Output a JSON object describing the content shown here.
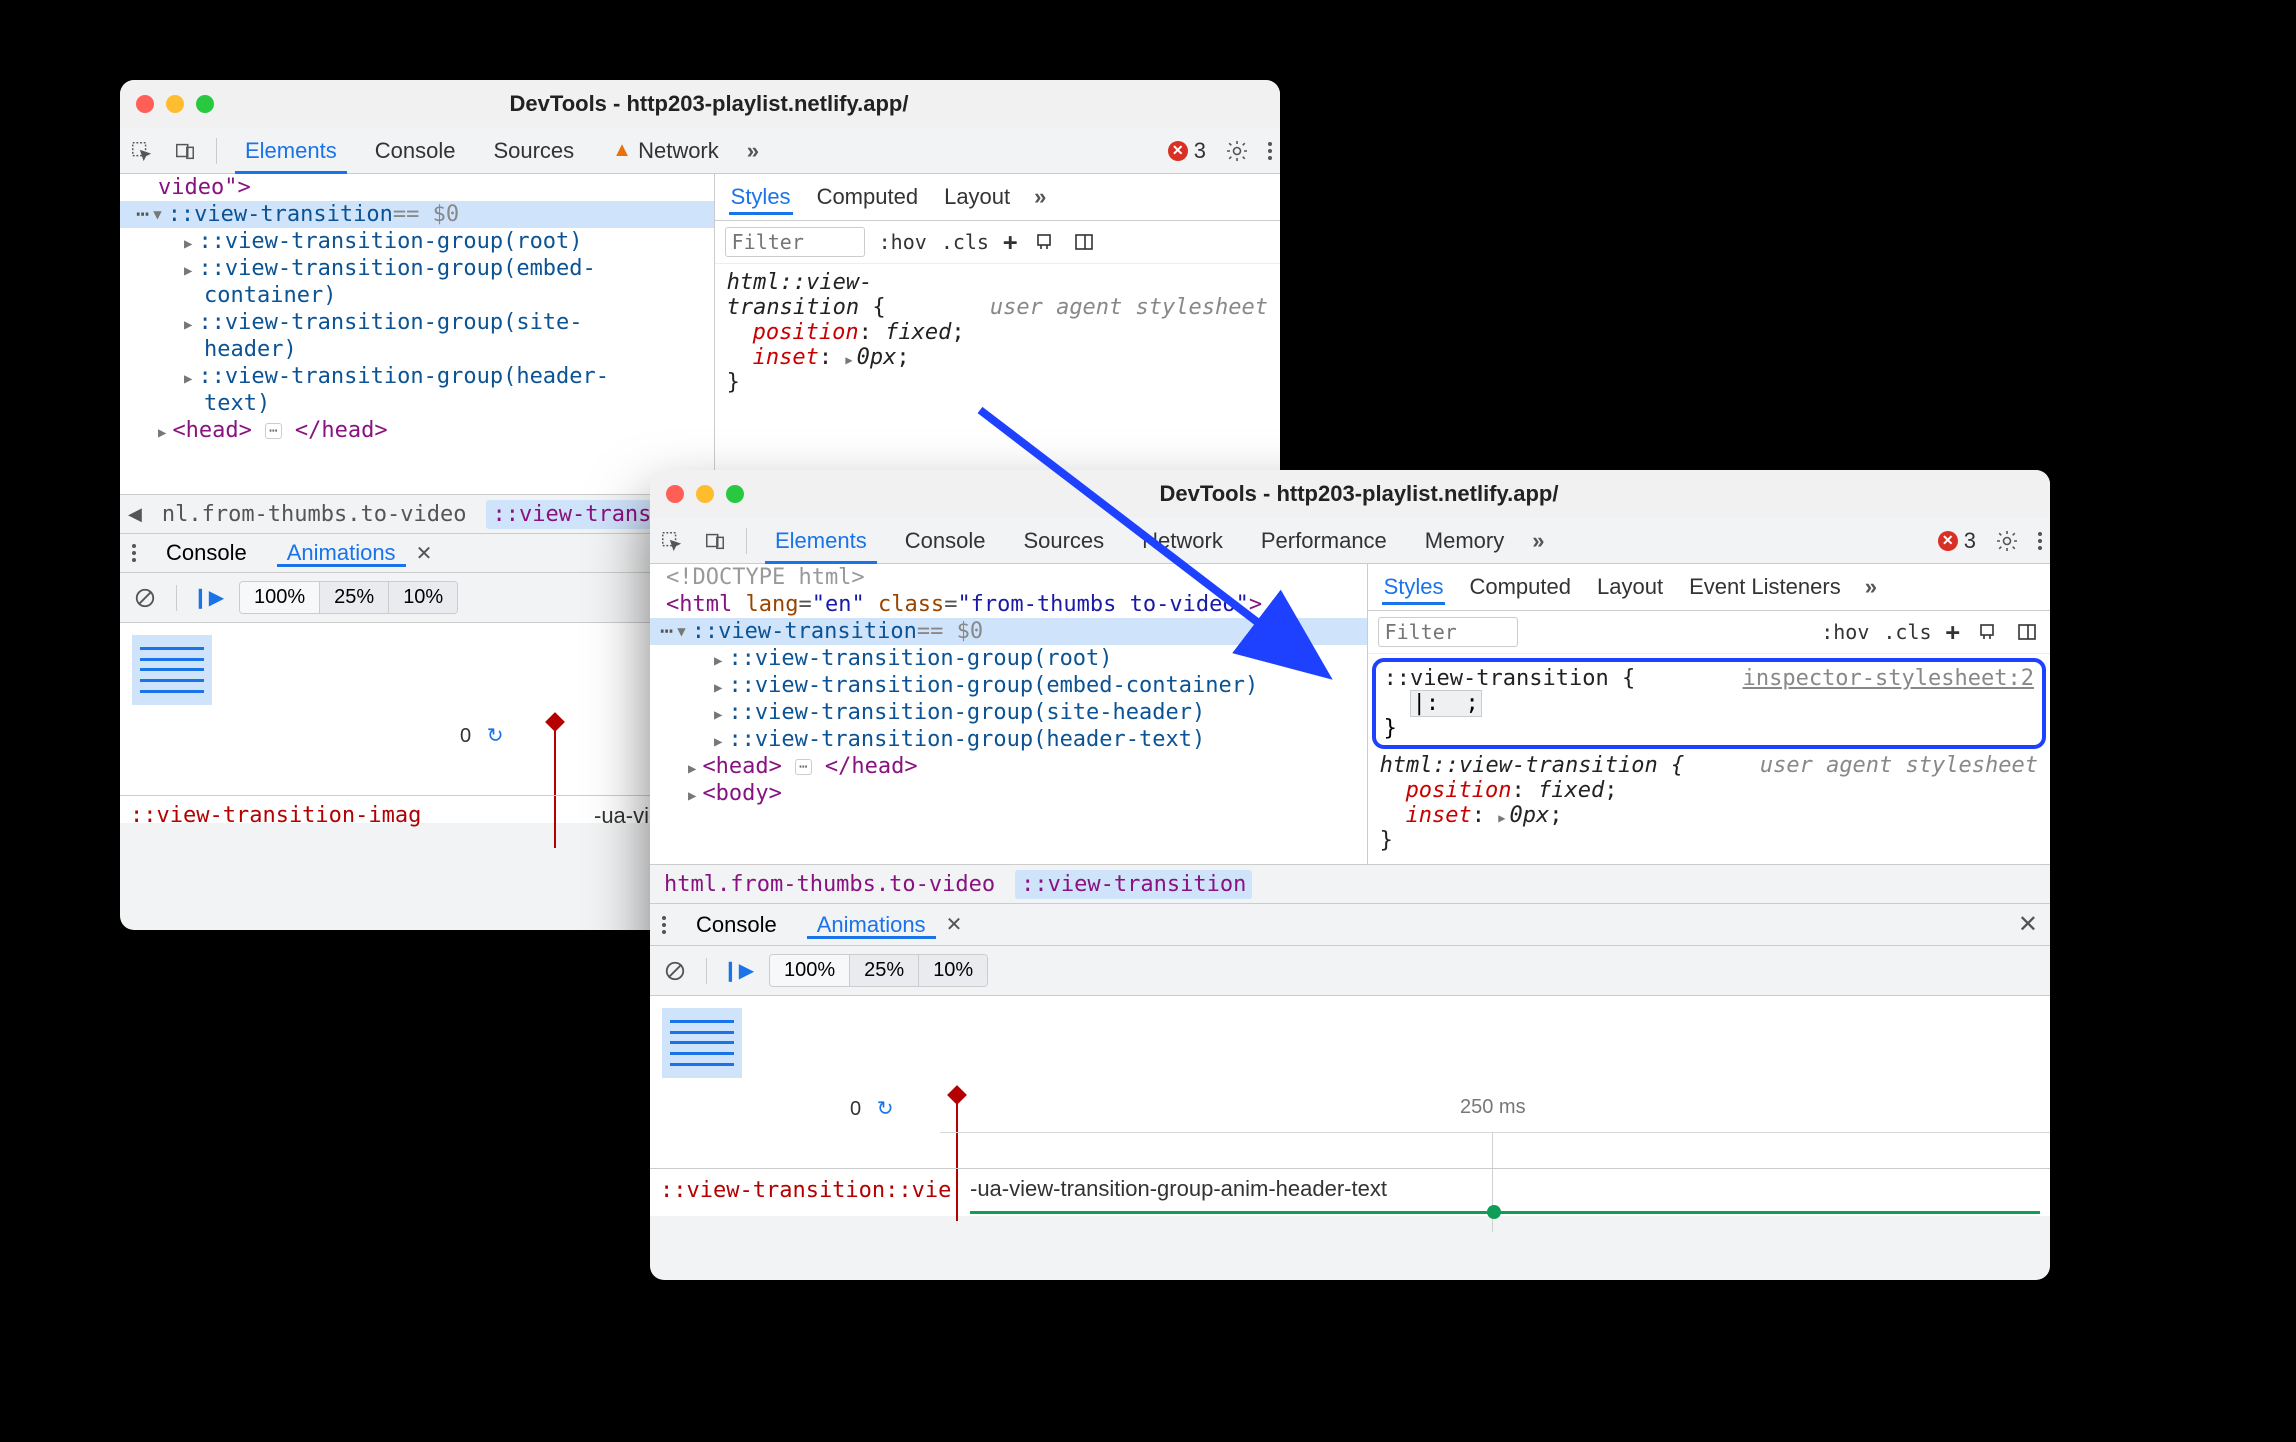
{
  "window1": {
    "title": "DevTools - http203-playlist.netlify.app/",
    "tabs": [
      "Elements",
      "Console",
      "Sources",
      "Network"
    ],
    "error_count": "3",
    "dom": {
      "line0": "video\">",
      "line1_sel": "::view-transition",
      "line1_eq": " == $0",
      "g1": "::view-transition-group(root)",
      "g2a": "::view-transition-group(embed-",
      "g2b": "container)",
      "g3a": "::view-transition-group(site-",
      "g3b": "header)",
      "g4a": "::view-transition-group(header-",
      "g4b": "text)",
      "head_open": "<head>",
      "head_close": "</head>"
    },
    "styles": {
      "tabs": [
        "Styles",
        "Computed",
        "Layout"
      ],
      "filter_ph": "Filter",
      "hov": ":hov",
      "cls": ".cls",
      "selector": "html::view-transition {",
      "source": "user agent stylesheet",
      "p_pos": "position",
      "v_pos": "fixed",
      "p_inset": "inset",
      "v_inset": "0px",
      "close": "}"
    },
    "crumbs": {
      "c1": "nl.from-thumbs.to-video",
      "c2": "::view-transition"
    },
    "drawer": {
      "console": "Console",
      "anim": "Animations"
    },
    "speeds": [
      "100%",
      "25%",
      "10%"
    ],
    "zero": "0",
    "track_l": "::view-transition-imag",
    "track_r": "-ua-view-tr"
  },
  "window2": {
    "title": "DevTools - http203-playlist.netlify.app/",
    "tabs": [
      "Elements",
      "Console",
      "Sources",
      "Network",
      "Performance",
      "Memory"
    ],
    "error_count": "3",
    "dom": {
      "doctype": "<!DOCTYPE html>",
      "html_open": "<html ",
      "lang": "lang",
      "lang_v": "\"en\"",
      "class": "class",
      "class_v": "\"from-thumbs to-video\"",
      "html_end": ">",
      "vt": "::view-transition",
      "vt_eq": " == $0",
      "g1": "::view-transition-group(root)",
      "g2": "::view-transition-group(embed-container)",
      "g3": "::view-transition-group(site-header)",
      "g4": "::view-transition-group(header-text)",
      "head_o": "<head>",
      "head_c": "</head>",
      "body_o": "<body>"
    },
    "crumbs": {
      "c1": "html.from-thumbs.to-video",
      "c2": "::view-transition"
    },
    "styles": {
      "tabs": [
        "Styles",
        "Computed",
        "Layout",
        "Event Listeners"
      ],
      "filter_ph": "Filter",
      "hov": ":hov",
      "cls": ".cls",
      "new_sel": "::view-transition {",
      "new_src": "inspector-stylesheet:2",
      "edit_line": "|:  ;",
      "new_close": "}",
      "ua_sel": "html::view-transition {",
      "ua_src": "user agent stylesheet",
      "p_pos": "position",
      "v_pos": "fixed",
      "p_inset": "inset",
      "v_inset": "0px",
      "ua_close": "}"
    },
    "drawer": {
      "console": "Console",
      "anim": "Animations"
    },
    "speeds": [
      "100%",
      "25%",
      "10%"
    ],
    "zero": "0",
    "ms": "250 ms",
    "track_l": "::view-transition::vie",
    "track_r": "-ua-view-transition-group-anim-header-text"
  }
}
